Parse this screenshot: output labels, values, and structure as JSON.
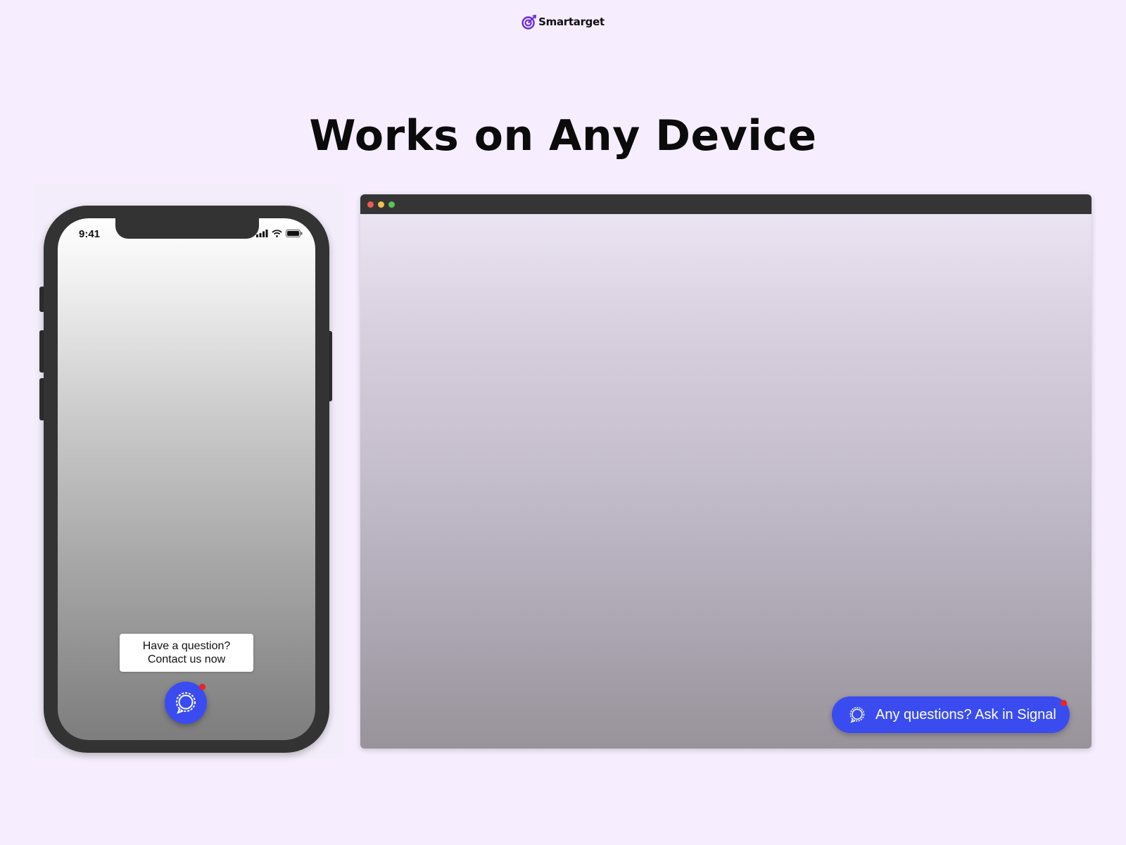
{
  "logo": {
    "text": "Smartarget",
    "icon": "target-arrow-icon",
    "color": "#6c2bd9"
  },
  "headline": "Works on Any Device",
  "phone": {
    "status_time": "9:41",
    "status_icons": [
      "signal-bars-icon",
      "wifi-icon",
      "battery-icon"
    ],
    "tooltip": {
      "line1": "Have a question?",
      "line2": "Contact us now"
    },
    "chat_button_icon": "signal-chat-icon"
  },
  "browser": {
    "traffic_lights": [
      "#ee5a52",
      "#f5be4f",
      "#5ec454"
    ],
    "chat_button_label": "Any questions? Ask in Signal",
    "chat_button_icon": "signal-chat-icon"
  },
  "colors": {
    "accent": "#3a4cf0",
    "notification": "#e8232a",
    "background": "#f6eefe"
  }
}
